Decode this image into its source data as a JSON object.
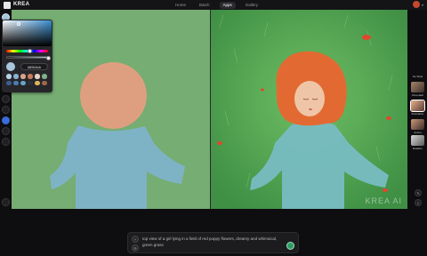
{
  "app": {
    "name": "KREA"
  },
  "nav": {
    "tabs": [
      {
        "label": "Home"
      },
      {
        "label": "Batch"
      },
      {
        "label": "Apps"
      },
      {
        "label": "Gallery"
      }
    ],
    "active": "Apps"
  },
  "tools": [
    {
      "icon": "color-swatch-icon"
    },
    {
      "icon": "undo-icon"
    },
    {
      "icon": "redo-icon"
    },
    {
      "icon": "brush-icon",
      "active": true
    },
    {
      "icon": "eraser-icon"
    },
    {
      "icon": "move-icon"
    },
    {
      "icon": "trash-icon"
    }
  ],
  "color_picker": {
    "hex": "#89b0cb",
    "current": "#a9c7dc",
    "swatches": [
      "#b8d2e8",
      "#8ab1cf",
      "#d9a48a",
      "#c97a5b",
      "#e6d5c1",
      "#7fb08a",
      "#3a5f8f",
      "#4b7db3",
      "#6aa2c9",
      "#2a2f3a",
      "#e0b35a",
      "#9b6a4a"
    ]
  },
  "styles": [
    {
      "label": "No Style"
    },
    {
      "label": "Cinematic"
    },
    {
      "label": "Illustration"
    },
    {
      "label": "Anime"
    },
    {
      "label": "Realism"
    }
  ],
  "active_style": "Illustration",
  "prompt": {
    "text": "top view of a girl lying in a field of red poppy flowers, dreamy and whimsical, green grass"
  },
  "watermark": "KREA AI"
}
